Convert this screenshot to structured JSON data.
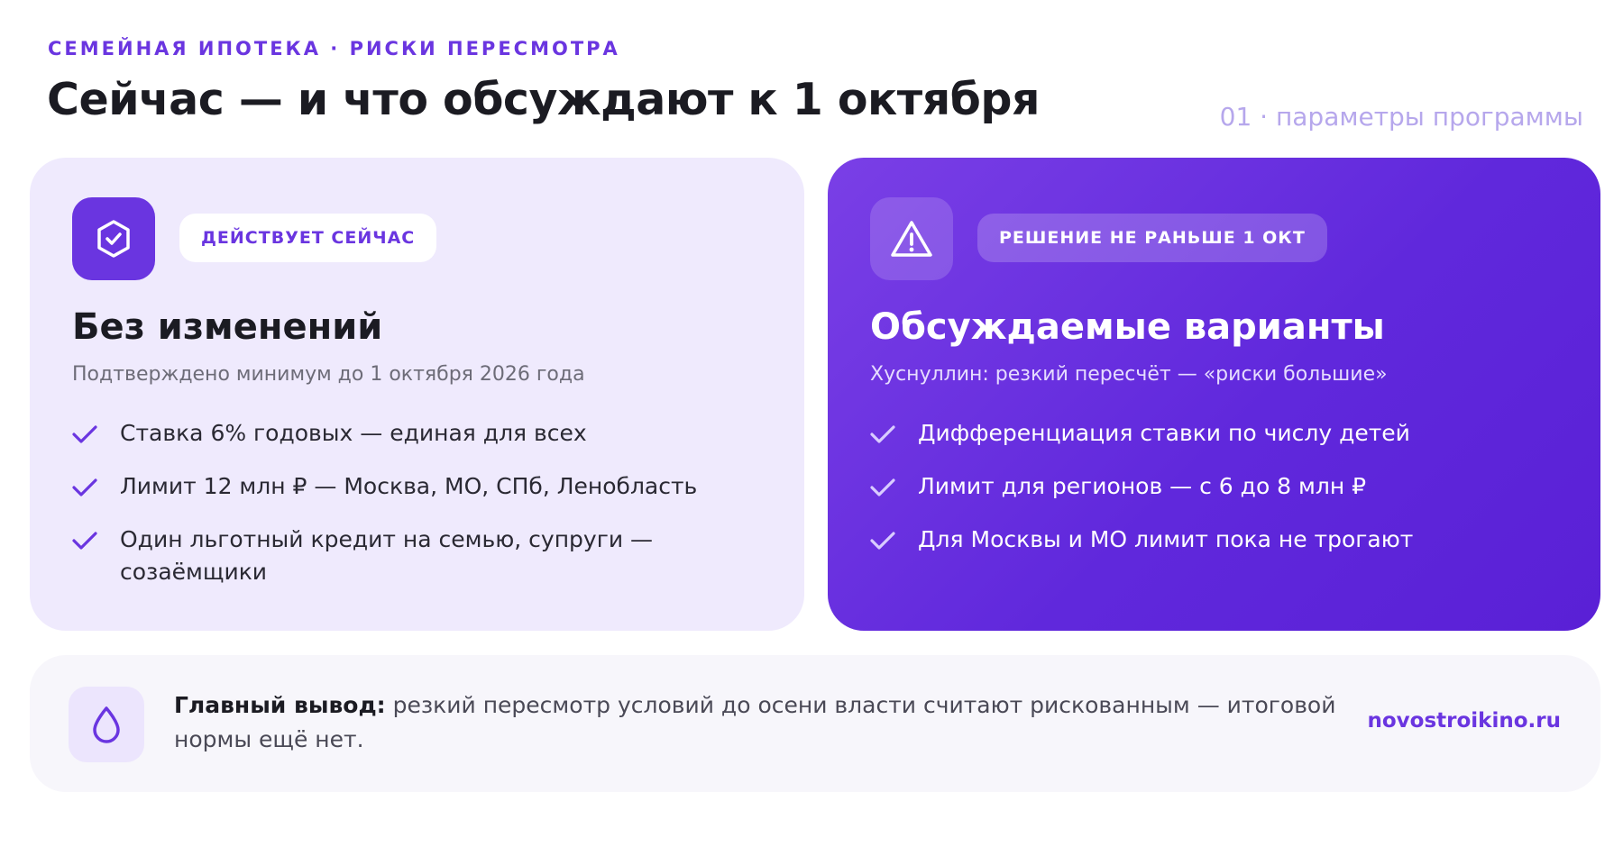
{
  "header": {
    "kicker": "СЕМЕЙНАЯ ИПОТЕКА · РИСКИ ПЕРЕСМОТРА",
    "title": "Сейчас — и что обсуждают к 1 октября",
    "page_label": "01 · параметры программы"
  },
  "cards": {
    "current": {
      "icon": "shield-check-icon",
      "badge": "ДЕЙСТВУЕТ СЕЙЧАС",
      "title": "Без изменений",
      "subtitle": "Подтверждено минимум до 1 октября 2026 года",
      "items": [
        "Ставка 6% годовых — единая для всех",
        "Лимит 12 млн ₽ — Москва, МО, СПб, Ленобласть",
        "Один льготный кредит на семью, супруги — созаёмщики"
      ]
    },
    "proposed": {
      "icon": "warning-triangle-icon",
      "badge": "РЕШЕНИЕ НЕ РАНЬШЕ 1 ОКТ",
      "title": "Обсуждаемые варианты",
      "subtitle": "Хуснуллин: резкий пересчёт — «риски большие»",
      "items": [
        "Дифференциация ставки по числу детей",
        "Лимит для регионов — с 6 до 8 млн ₽",
        "Для Москвы и МО лимит пока не трогают"
      ]
    }
  },
  "footer": {
    "icon": "drop-icon",
    "lead": "Главный вывод:",
    "text": " резкий пересмотр условий до осени власти считают рискованным — итоговой нормы ещё нет.",
    "site": "novostroikino.ru"
  },
  "colors": {
    "accent": "#6a35e0",
    "left_card_bg": "#efeafd",
    "right_card_bg": "#6028dc",
    "footer_bg": "#f7f6fb",
    "page_label": "#b6a7ec"
  }
}
